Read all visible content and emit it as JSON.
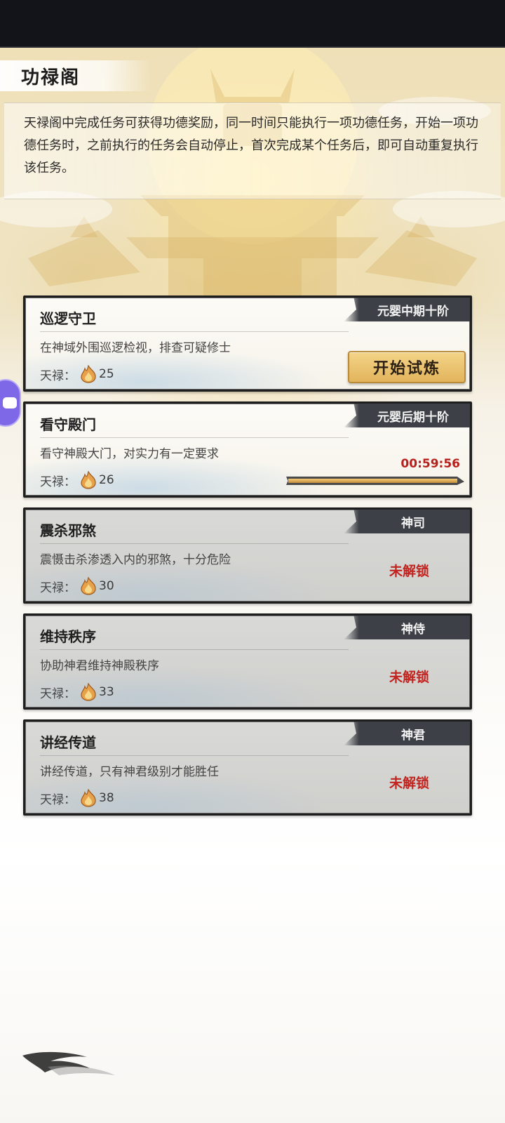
{
  "header": {
    "title": "功禄阁",
    "description": "天禄阁中完成任务可获得功德奖励，同一时间只能执行一项功德任务，开始一项功德任务时，之前执行的任务会自动停止，首次完成某个任务后，即可自动重复执行该任务。"
  },
  "reward_label": "天禄：",
  "tasks": [
    {
      "title": "巡逻守卫",
      "tier": "元婴中期十阶",
      "desc": "在神域外围巡逻检视，排查可疑修士",
      "reward": "25",
      "action_label": "开始试炼"
    },
    {
      "title": "看守殿门",
      "tier": "元婴后期十阶",
      "desc": "看守神殿大门，对实力有一定要求",
      "reward": "26",
      "timer": "00:59:56"
    },
    {
      "title": "震杀邪煞",
      "tier": "神司",
      "desc": "震慑击杀渗透入内的邪煞，十分危险",
      "reward": "30",
      "status": "未解锁"
    },
    {
      "title": "维持秩序",
      "tier": "神侍",
      "desc": "协助神君维持神殿秩序",
      "reward": "33",
      "status": "未解锁"
    },
    {
      "title": "讲经传道",
      "tier": "神君",
      "desc": "讲经传道，只有神君级别才能胜任",
      "reward": "38",
      "status": "未解锁"
    }
  ],
  "progress_fraction": 0.97,
  "icons": {
    "reward": "flame-icon",
    "side": "gamepad-icon",
    "decoration": "ink-brush-icon"
  },
  "colors": {
    "timer": "#b8201d",
    "locked_text": "#c1241f",
    "button": "#e8bd68",
    "tier_tag": "#3d4046"
  }
}
